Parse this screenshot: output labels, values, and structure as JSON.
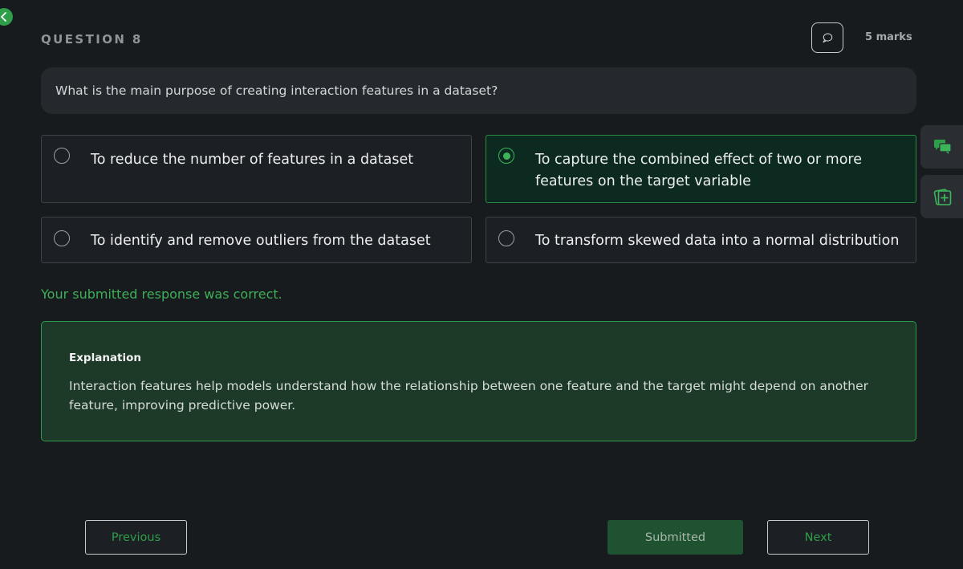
{
  "question": {
    "label": "QUESTION 8",
    "marks": "5 marks",
    "text": "What is the main purpose of creating interaction features in a dataset?"
  },
  "options": [
    {
      "text": "To reduce the number of features in a dataset",
      "selected": false
    },
    {
      "text": "To capture the combined effect of two or more features on the target variable",
      "selected": true
    },
    {
      "text": "To identify and remove outliers from the dataset",
      "selected": false
    },
    {
      "text": "To transform skewed data into a normal distribution",
      "selected": false
    }
  ],
  "result_text": "Your submitted response was correct.",
  "explanation": {
    "title": "Explanation",
    "body": "Interaction features help models understand how the relationship between one feature and the target might depend on another feature, improving predictive power."
  },
  "buttons": {
    "previous": "Previous",
    "submitted": "Submitted",
    "next": "Next"
  },
  "icons": {
    "back": "back-arrow-icon",
    "comment": "comment-icon",
    "chat": "chat-bubbles-icon",
    "add_note": "add-note-icon"
  },
  "colors": {
    "accent": "#2f9e48",
    "selected_bg": "#0d2a20",
    "explanation_bg": "#1c3a27"
  }
}
